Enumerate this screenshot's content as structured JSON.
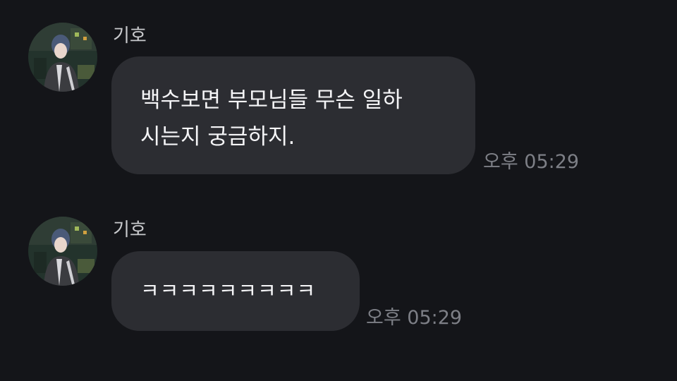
{
  "messages": [
    {
      "sender": "기호",
      "text": "백수보면 부모님들 무슨 일하\n시는지 궁금하지.",
      "time": "오후 05:29"
    },
    {
      "sender": "기호",
      "text": "ㅋㅋㅋㅋㅋㅋㅋㅋㅋ",
      "time": "오후 05:29"
    }
  ],
  "colors": {
    "background": "#141519",
    "bubble": "#2c2d32",
    "sender_text": "#c9cacd",
    "time_text": "#7d7f86"
  }
}
